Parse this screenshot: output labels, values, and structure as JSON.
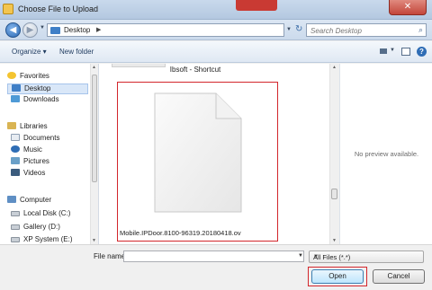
{
  "window": {
    "title": "Choose File to Upload",
    "close_glyph": "✕"
  },
  "address_bar": {
    "back_glyph": "◀",
    "forward_glyph": "▶",
    "crumb": "Desktop",
    "crumb_arrow": "▶",
    "dropdown_glyph": "▼",
    "refresh_glyph": "↻",
    "search_placeholder": "Search Desktop",
    "search_glyph": "⌕"
  },
  "toolbar": {
    "organize_label": "Organize ▾",
    "new_folder_label": "New folder",
    "view_dropdown_glyph": "▼",
    "help_glyph": "?"
  },
  "nav_pane": {
    "favorites": {
      "label": "Favorites",
      "icon": "star-icon"
    },
    "favorites_items": [
      {
        "label": "Desktop",
        "icon": "desktop-icon",
        "selected": true
      },
      {
        "label": "Downloads",
        "icon": "downloads-icon"
      }
    ],
    "libraries": {
      "label": "Libraries",
      "icon": "libraries-icon"
    },
    "libraries_items": [
      {
        "label": "Documents",
        "icon": "documents-icon"
      },
      {
        "label": "Music",
        "icon": "music-icon"
      },
      {
        "label": "Pictures",
        "icon": "pictures-icon"
      },
      {
        "label": "Videos",
        "icon": "videos-icon"
      }
    ],
    "computer": {
      "label": "Computer",
      "icon": "computer-icon"
    },
    "computer_items": [
      {
        "label": "Local Disk (C:)",
        "icon": "drive-icon"
      },
      {
        "label": "Gallery (D:)",
        "icon": "drive-icon"
      },
      {
        "label": "XP System (E:)",
        "icon": "drive-icon"
      }
    ]
  },
  "content": {
    "top_label": "Ibsoft - Shortcut",
    "file_name": "Mobile.IPDoor.8100-96319.20180418.ov",
    "file_icon": "blank-document-icon"
  },
  "preview": {
    "message": "No preview available."
  },
  "bottom": {
    "file_name_label": "File name:",
    "file_name_value": "",
    "file_type_filter": "All Files (*.*)",
    "open_label": "Open",
    "cancel_label": "Cancel"
  },
  "colors": {
    "highlight_red": "#d3262c",
    "title_close": "#c3463a",
    "selected_bg": "#d9e7f8"
  }
}
